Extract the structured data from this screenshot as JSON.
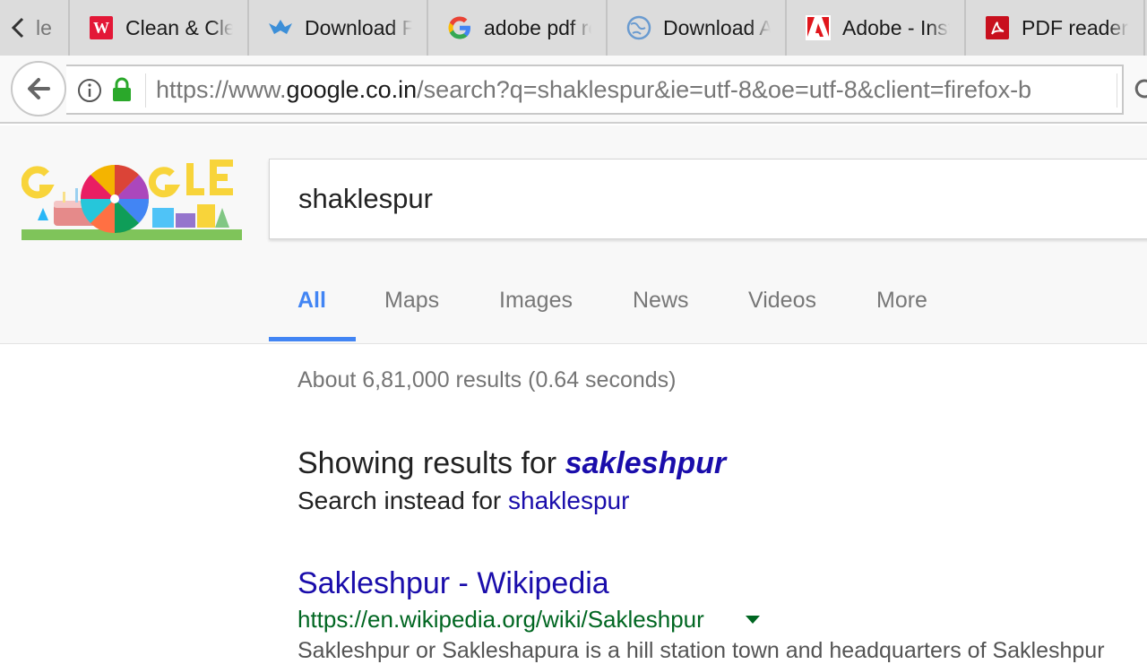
{
  "browser": {
    "first_tab_partial": "le",
    "tabs": [
      {
        "label": "Clean & Clear",
        "icon": "walgreens-icon"
      },
      {
        "label": "Download Free",
        "icon": "bird-icon"
      },
      {
        "label": "adobe pdf reader",
        "icon": "google-icon"
      },
      {
        "label": "Download Adobe",
        "icon": "globe-icon"
      },
      {
        "label": "Adobe - Install",
        "icon": "adobe-icon"
      },
      {
        "label": "PDF reader",
        "icon": "pdf-icon"
      }
    ],
    "url_prefix": "https://www.",
    "url_domain": "google.co.in",
    "url_path": "/search?q=shaklespur&ie=utf-8&oe=utf-8&client=firefox-b"
  },
  "search": {
    "query": "shaklespur",
    "tabs": [
      "All",
      "Maps",
      "Images",
      "News",
      "Videos",
      "More"
    ],
    "active_tab": "All"
  },
  "results": {
    "stats": "About 6,81,000 results (0.64 seconds)",
    "showing_prefix": "Showing results for ",
    "corrected_query": "sakleshpur",
    "instead_prefix": "Search instead for ",
    "original_query": "shaklespur",
    "items": [
      {
        "title": "Sakleshpur - Wikipedia",
        "url": "https://en.wikipedia.org/wiki/Sakleshpur",
        "snippet": "Sakleshpur or Sakleshapura is a hill station town and headquarters of Sakleshpur"
      }
    ]
  },
  "colors": {
    "link": "#1a0dab",
    "url_green": "#006621",
    "active_tab": "#4285f4",
    "lock_green": "#2aa82a"
  }
}
